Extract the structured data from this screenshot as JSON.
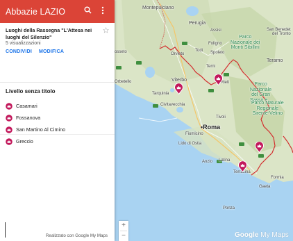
{
  "header": {
    "title": "Abbazie LAZIO"
  },
  "map_info": {
    "description": "Luoghi della Rassegna \"L'Attesa nei luoghi del Silenzio\"",
    "views": "5 visualizzazioni",
    "share_label": "CONDIVIDI",
    "edit_label": "MODIFICA"
  },
  "layer": {
    "title": "Livello senza titolo",
    "items": [
      {
        "label": "Casamari"
      },
      {
        "label": "Fossanova"
      },
      {
        "label": "San Martino Al Cimino"
      },
      {
        "label": "Greccio"
      }
    ]
  },
  "footer": {
    "credit": "Realizzato con Google My Maps"
  },
  "zoom": {
    "in": "+",
    "out": "−"
  },
  "logo": {
    "google": "Google",
    "mymaps": "My Maps"
  },
  "map_labels": {
    "montepulciano": "Montepulciano",
    "perugia": "Perugia",
    "assisi": "Assisi",
    "san_benedetto": "San Benedet\ndel Tronto",
    "foligno": "Foligno",
    "parco_sibillini": "Parco\nNazionale dei\nMonti Sibillini",
    "grosseto": "osseto",
    "orvieto": "Orvieto",
    "todi": "Todi",
    "spoleto": "Spoleto",
    "teramo": "Teramo",
    "terni": "Terni",
    "rieti": "Rieti",
    "viterbo": "Viterbo",
    "orbetello": "Orbetello",
    "tarquinia": "Tarquinia",
    "parco_gran_sasso": "Parco\nNazionale\ndel Gran\nSasso e...",
    "civitavecchia": "Civitavecchia",
    "parco_sirente": "Parco Naturale\nRegionale\nSirente-Velino",
    "tivoli": "Tivoli",
    "fiumicino": "Fiumicino",
    "roma": "Roma",
    "lido_ostia": "Lido di Ostia",
    "anzio": "Anzio",
    "latina": "Latina",
    "terracina": "Terracina",
    "formia": "Formia",
    "gaeta": "Gaeta",
    "ponza": "Ponza"
  },
  "colors": {
    "header": "#db4437",
    "action": "#1a73e8",
    "marker": "#c2185b",
    "border": "#d32f2f",
    "sea": "#aadaff",
    "land": "#dfe8cc"
  }
}
